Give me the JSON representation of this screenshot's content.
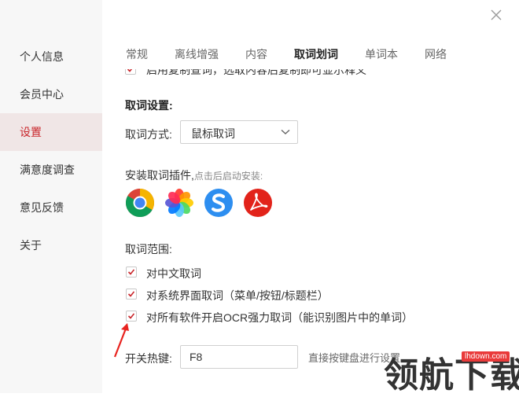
{
  "sidebar": {
    "items": [
      {
        "label": "个人信息"
      },
      {
        "label": "会员中心"
      },
      {
        "label": "设置"
      },
      {
        "label": "满意度调查"
      },
      {
        "label": "意见反馈"
      },
      {
        "label": "关于"
      }
    ],
    "active_index": 2
  },
  "tabs": [
    "常规",
    "离线增强",
    "内容",
    "取词划词",
    "单词本",
    "网络"
  ],
  "active_tab": "取词划词",
  "cut_off_option": "启用复制查词，选取内容后复制即可显示释义",
  "word_capture": {
    "section_title": "取词设置:",
    "method_label": "取词方式:",
    "method_value": "鼠标取词"
  },
  "plugins": {
    "label": "安装取词插件,",
    "hint": "点击后启动安装:",
    "items": [
      "chrome-icon",
      "photos-icon",
      "sogou-browser-icon",
      "acrobat-icon"
    ]
  },
  "scope": {
    "title": "取词范围:",
    "options": [
      {
        "label": "对中文取词",
        "checked": true
      },
      {
        "label": "对系统界面取词（菜单/按钮/标题栏）",
        "checked": true
      },
      {
        "label": "对所有软件开启OCR强力取词（能识别图片中的单词）",
        "checked": true
      }
    ]
  },
  "hotkey": {
    "label": "开关热键:",
    "value": "F8",
    "hint": "直接按键盘进行设置"
  },
  "watermark": {
    "text": "领航下载",
    "url": "lhdown.com"
  },
  "colors": {
    "accent": "#c9262b",
    "sidebar_bg": "#f7f7f7",
    "active_bg": "#f0e6e6"
  }
}
